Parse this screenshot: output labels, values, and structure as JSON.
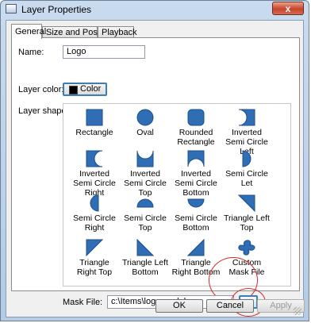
{
  "window": {
    "title": "Layer Properties",
    "close_label": "x"
  },
  "tabs": [
    {
      "label": "General"
    },
    {
      "label": "Size and Position"
    },
    {
      "label": "Playback"
    }
  ],
  "general": {
    "name_label": "Name:",
    "name_value": "Logo",
    "color_label": "Layer color:",
    "color_button_label": "Color",
    "color_swatch": "#000000",
    "shape_label": "Layer shape:",
    "shapes": [
      {
        "label": "Rectangle",
        "icon": "rectangle-shape-icon"
      },
      {
        "label": "Oval",
        "icon": "oval-shape-icon"
      },
      {
        "label": "Rounded Rectangle",
        "icon": "rounded-rectangle-shape-icon"
      },
      {
        "label": "Inverted Semi Circle Left",
        "icon": "inverted-semi-circle-left-shape-icon"
      },
      {
        "label": "Inverted Semi Circle Right",
        "icon": "inverted-semi-circle-right-shape-icon"
      },
      {
        "label": "Inverted Semi Circle Top",
        "icon": "inverted-semi-circle-top-shape-icon"
      },
      {
        "label": "Inverted Semi Circle Bottom",
        "icon": "inverted-semi-circle-bottom-shape-icon"
      },
      {
        "label": "Semi Circle Let",
        "icon": "semi-circle-left-shape-icon"
      },
      {
        "label": "Semi Circle Right",
        "icon": "semi-circle-right-shape-icon"
      },
      {
        "label": "Semi Circle Top",
        "icon": "semi-circle-top-shape-icon"
      },
      {
        "label": "Semi Circle Bottom",
        "icon": "semi-circle-bottom-shape-icon"
      },
      {
        "label": "Triangle Left Top",
        "icon": "triangle-left-top-shape-icon"
      },
      {
        "label": "Triangle Right Top",
        "icon": "triangle-right-top-shape-icon"
      },
      {
        "label": "Triangle Left Bottom",
        "icon": "triangle-left-bottom-shape-icon"
      },
      {
        "label": "Triangle Right Bottom",
        "icon": "triangle-right-bottom-shape-icon"
      },
      {
        "label": "Custom Mask File",
        "icon": "custom-mask-shape-icon"
      }
    ],
    "mask_label": "Mask File:",
    "mask_value": "c:\\Items\\logomask.bmp",
    "browse_label": "..."
  },
  "buttons": {
    "ok": "OK",
    "cancel": "Cancel",
    "apply": "Apply"
  },
  "colors": {
    "accent": "#3c7fb1",
    "shape_fill": "#2f6db5",
    "highlight": "#d7262a"
  }
}
